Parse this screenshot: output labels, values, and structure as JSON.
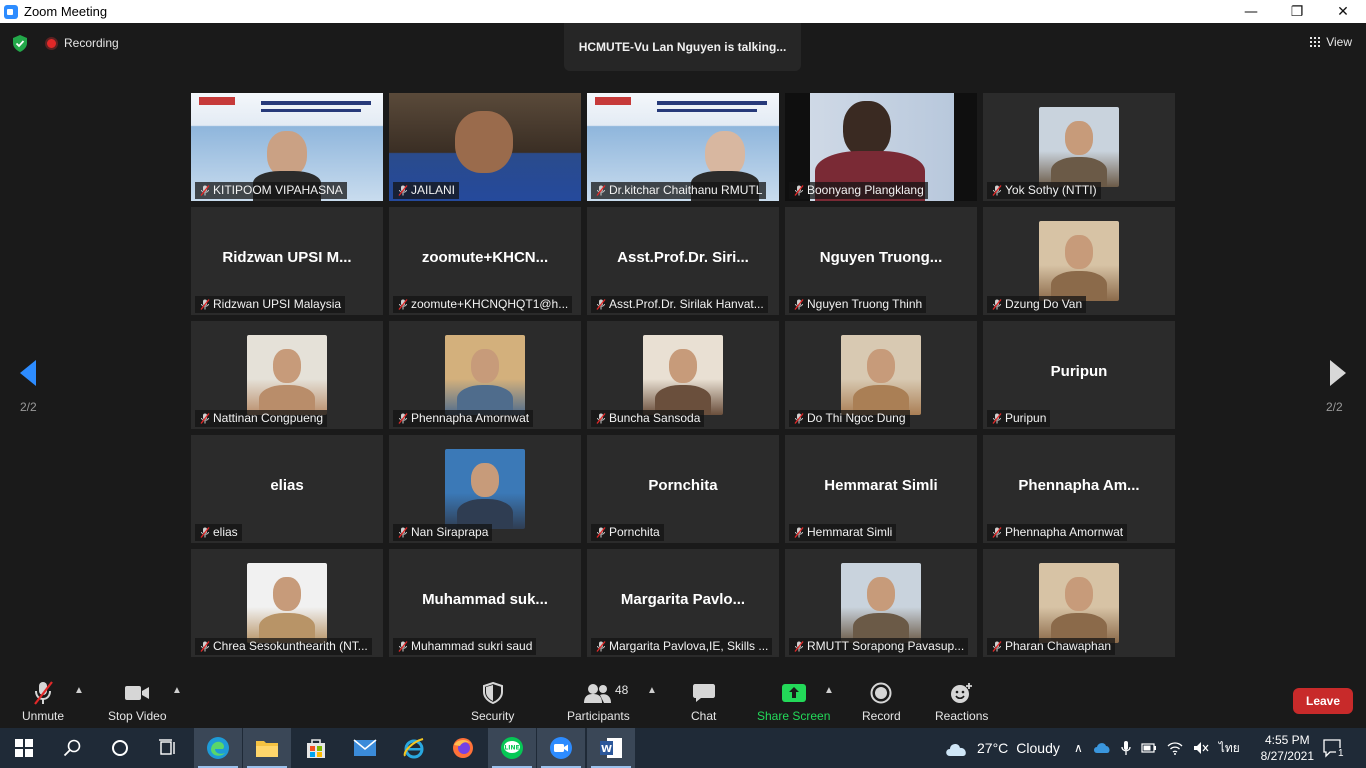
{
  "window": {
    "title": "Zoom Meeting",
    "controls": [
      "—",
      "❐",
      "✕"
    ]
  },
  "top": {
    "recording_label": "Recording",
    "talking_banner": "HCMUTE-Vu Lan Nguyen is talking...",
    "view_label": "View"
  },
  "pager": {
    "left_label": "2/2",
    "right_label": "2/2"
  },
  "participants": [
    {
      "display": "",
      "label": "KITIPOOM VIPAHASNA",
      "kind": "video"
    },
    {
      "display": "",
      "label": "JAILANI",
      "kind": "video"
    },
    {
      "display": "",
      "label": "Dr.kitchar Chaithanu RMUTL",
      "kind": "video"
    },
    {
      "display": "",
      "label": "Boonyang Plangklang",
      "kind": "video"
    },
    {
      "display": "",
      "label": "Yok Sothy (NTTI)",
      "kind": "photo"
    },
    {
      "display": "Ridzwan  UPSI  M...",
      "label": "Ridzwan UPSI Malaysia",
      "kind": "name"
    },
    {
      "display": "zoomute+KHCN...",
      "label": "zoomute+KHCNQHQT1@h...",
      "kind": "name"
    },
    {
      "display": "Asst.Prof.Dr.  Siri...",
      "label": "Asst.Prof.Dr. Sirilak Hanvat...",
      "kind": "name"
    },
    {
      "display": "Nguyen  Truong...",
      "label": "Nguyen Truong Thinh",
      "kind": "name"
    },
    {
      "display": "",
      "label": "Dzung Do Van",
      "kind": "photo"
    },
    {
      "display": "",
      "label": "Nattinan Congpueng",
      "kind": "photo"
    },
    {
      "display": "",
      "label": "Phennapha Amornwat",
      "kind": "photo"
    },
    {
      "display": "",
      "label": "Buncha Sansoda",
      "kind": "photo"
    },
    {
      "display": "",
      "label": "Do Thi Ngoc Dung",
      "kind": "photo"
    },
    {
      "display": "Puripun",
      "label": "Puripun",
      "kind": "name"
    },
    {
      "display": "elias",
      "label": "elias",
      "kind": "name"
    },
    {
      "display": "",
      "label": "Nan Siraprapa",
      "kind": "photo"
    },
    {
      "display": "Pornchita",
      "label": "Pornchita",
      "kind": "name"
    },
    {
      "display": "Hemmarat Simli",
      "label": "Hemmarat Simli",
      "kind": "name"
    },
    {
      "display": "Phennapha  Am...",
      "label": "Phennapha Amornwat",
      "kind": "name"
    },
    {
      "display": "",
      "label": "Chrea Sesokunthearith (NT...",
      "kind": "photo"
    },
    {
      "display": "Muhammad  suk...",
      "label": "Muhammad sukri saud",
      "kind": "name"
    },
    {
      "display": "Margarita  Pavlo...",
      "label": "Margarita Pavlova,IE, Skills ...",
      "kind": "name"
    },
    {
      "display": "",
      "label": "RMUTT Sorapong Pavasup...",
      "kind": "photo"
    },
    {
      "display": "",
      "label": "Pharan Chawaphan",
      "kind": "photo"
    }
  ],
  "toolbar": {
    "unmute": "Unmute",
    "stop_video": "Stop Video",
    "security": "Security",
    "participants": "Participants",
    "participants_count": "48",
    "chat": "Chat",
    "share_screen": "Share Screen",
    "record": "Record",
    "reactions": "Reactions",
    "leave": "Leave"
  },
  "taskbar": {
    "weather_temp": "27°C",
    "weather_desc": "Cloudy",
    "input_lang": "ไทย",
    "time": "4:55 PM",
    "date": "8/27/2021",
    "notification_count": "1"
  },
  "colors": {
    "accent_green": "#23d959",
    "leave_red": "#c82a2a",
    "zoom_blue": "#2d8cff",
    "nav_blue": "#2d8cff"
  }
}
